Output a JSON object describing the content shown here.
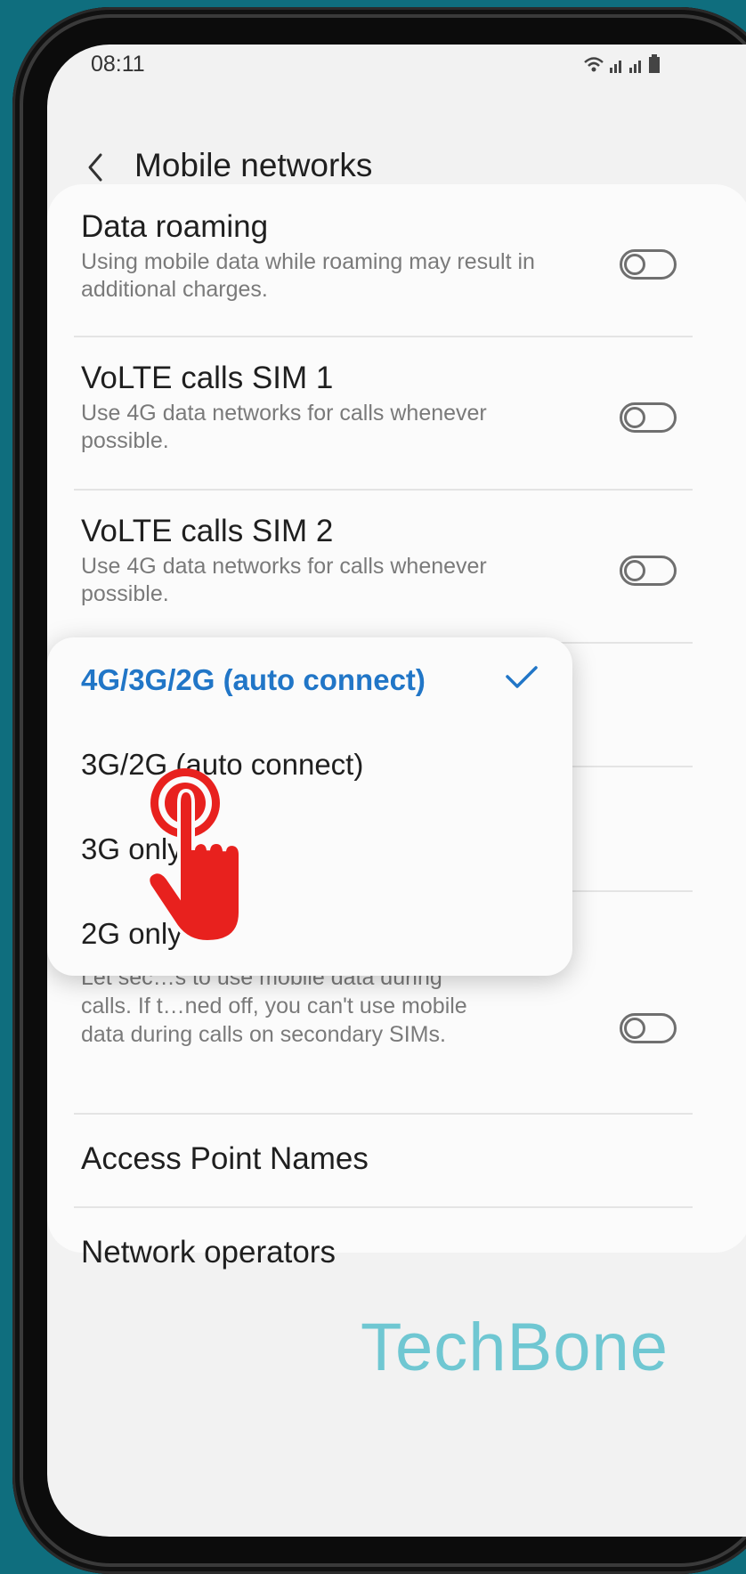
{
  "status_bar": {
    "time": "08:11"
  },
  "header": {
    "title": "Mobile networks"
  },
  "settings": [
    {
      "title": "Data roaming",
      "desc": "Using mobile data while roaming may result in additional charges.",
      "toggle": false
    },
    {
      "title": "VoLTE calls SIM 1",
      "desc": "Use 4G data networks for calls whenever possible.",
      "toggle": false
    },
    {
      "title": "VoLTE calls SIM 2",
      "desc": "Use 4G data networks for calls whenever possible.",
      "toggle": false
    },
    {
      "title": "",
      "desc_partial_line1": "Let sec…s to use mobile data during",
      "desc_partial_line2": "calls. If t…ned off, you can't use mobile",
      "desc_partial_line3": "data during calls on secondary SIMs.",
      "toggle": false
    },
    {
      "title": "Access Point Names"
    },
    {
      "title": "Network operators"
    }
  ],
  "network_mode_popup": {
    "options": [
      {
        "label": "4G/3G/2G (auto connect)",
        "selected": true
      },
      {
        "label": "3G/2G (auto connect)",
        "selected": false
      },
      {
        "label": "3G only",
        "selected": false
      },
      {
        "label": "2G only",
        "selected": false
      }
    ],
    "selected_color": "#2176c7"
  },
  "icons": {
    "back": "chevron-left-icon",
    "check": "check-icon",
    "tap": "tap-hand-icon",
    "wifi": "wifi-icon",
    "signal": "signal-icon",
    "battery": "battery-icon"
  },
  "watermark": "TechBone",
  "colors": {
    "background": "#0f6e7e",
    "accent": "#2176c7",
    "tap_icon": "#e8211e",
    "watermark": "#6fc7d2"
  }
}
